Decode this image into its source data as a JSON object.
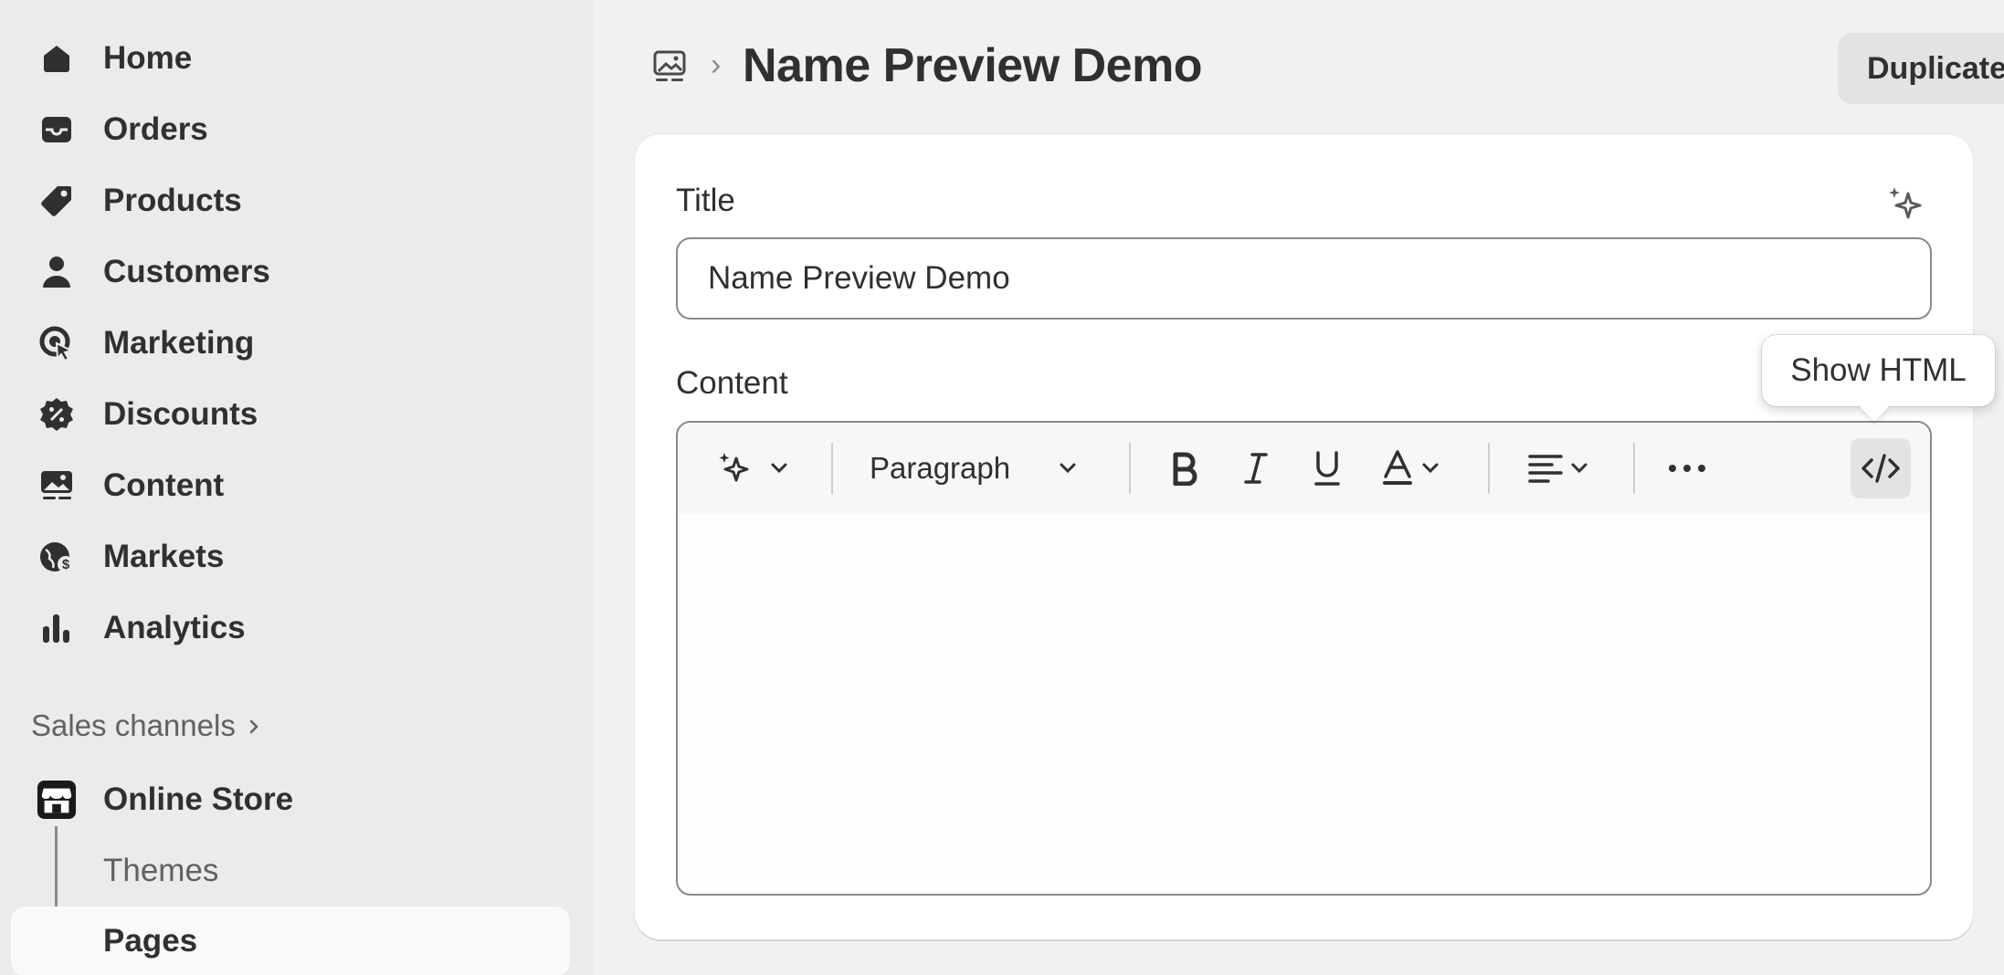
{
  "sidebar": {
    "items": [
      {
        "label": "Home",
        "icon": "home-icon"
      },
      {
        "label": "Orders",
        "icon": "inbox-icon"
      },
      {
        "label": "Products",
        "icon": "tag-icon"
      },
      {
        "label": "Customers",
        "icon": "person-icon"
      },
      {
        "label": "Marketing",
        "icon": "target-icon"
      },
      {
        "label": "Discounts",
        "icon": "discount-icon"
      },
      {
        "label": "Content",
        "icon": "image-icon"
      },
      {
        "label": "Markets",
        "icon": "globe-icon"
      },
      {
        "label": "Analytics",
        "icon": "bar-chart-icon"
      }
    ],
    "sales_channels_label": "Sales channels",
    "online_store": {
      "label": "Online Store",
      "icon": "store-icon"
    },
    "sub_items": [
      {
        "label": "Themes"
      },
      {
        "label": "Pages"
      }
    ]
  },
  "header": {
    "title": "Name Preview Demo",
    "duplicate_label": "Duplicate"
  },
  "form": {
    "title_label": "Title",
    "title_value": "Name Preview Demo",
    "content_label": "Content",
    "format_label": "Paragraph",
    "tooltip": "Show HTML"
  },
  "colors": {
    "sidebar_bg": "#ebebeb",
    "main_bg": "#f1f1f1",
    "text": "#303030",
    "muted": "#616161",
    "card_bg": "#ffffff"
  }
}
